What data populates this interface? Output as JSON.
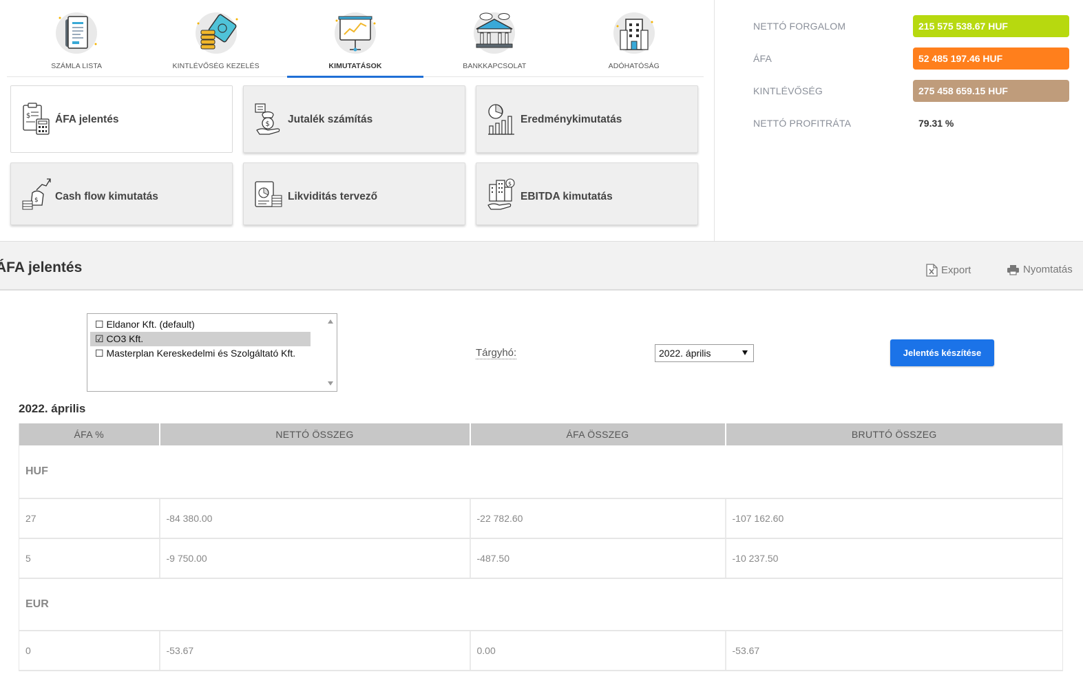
{
  "nav": {
    "tabs": [
      {
        "label": "SZÁMLA LISTA",
        "icon": "invoice-list-icon"
      },
      {
        "label": "KINTLÉVŐSÉG KEZELÉS",
        "icon": "receivables-icon"
      },
      {
        "label": "KIMUTATÁSOK",
        "icon": "reports-presentation-icon"
      },
      {
        "label": "BANKKAPCSOLAT",
        "icon": "bank-icon"
      },
      {
        "label": "ADÓHATÓSÁG",
        "icon": "tax-office-icon"
      }
    ],
    "active": "KIMUTATÁSOK"
  },
  "report_cards": [
    {
      "label": "ÁFA jelentés",
      "icon": "vat-calculator-icon"
    },
    {
      "label": "Jutalék számítás",
      "icon": "commission-hand-icon"
    },
    {
      "label": "Eredménykimutatás",
      "icon": "income-chart-icon"
    },
    {
      "label": "Cash flow kimutatás",
      "icon": "cash-flow-icon"
    },
    {
      "label": "Likviditás tervező",
      "icon": "liquidity-planner-icon"
    },
    {
      "label": "EBITDA kimutatás",
      "icon": "ebitda-icon"
    }
  ],
  "stats": [
    {
      "label": "NETTÓ FORGALOM",
      "value": "215 575 538.67 HUF",
      "color": "#b7d90f"
    },
    {
      "label": "ÁFA",
      "value": "52 485 197.46 HUF",
      "color": "#ff7f1c"
    },
    {
      "label": "KINTLÉVŐSÉG",
      "value": "275 458 659.15 HUF",
      "color": "#bf9c7b"
    },
    {
      "label": "NETTÓ PROFITRÁTA",
      "value": "79.31 %",
      "color": ""
    }
  ],
  "section": {
    "title": "ÁFA jelentés",
    "export_label": "Export",
    "print_label": "Nyomtatás"
  },
  "filters": {
    "companies": [
      {
        "label": "☐ Eldanor Kft. (default)",
        "checked": false
      },
      {
        "label": "☑ CO3 Kft.",
        "checked": true
      },
      {
        "label": "☐ Masterplan Kereskedelmi és Szolgáltató Kft.",
        "checked": false
      }
    ],
    "period_label": "Tárgyhó:",
    "period_value": "2022. április",
    "submit_label": "Jelentés készítése"
  },
  "report": {
    "period_title": "2022. április",
    "columns": [
      "ÁFA %",
      "NETTÓ ÖSSZEG",
      "ÁFA ÖSSZEG",
      "BRUTTÓ ÖSSZEG"
    ],
    "groups": [
      {
        "currency": "HUF",
        "rows": [
          [
            "27",
            "-84 380.00",
            "-22 782.60",
            "-107 162.60"
          ],
          [
            "5",
            "-9 750.00",
            "-487.50",
            "-10 237.50"
          ]
        ]
      },
      {
        "currency": "EUR",
        "rows": [
          [
            "0",
            "-53.67",
            "0.00",
            "-53.67"
          ]
        ]
      }
    ]
  }
}
